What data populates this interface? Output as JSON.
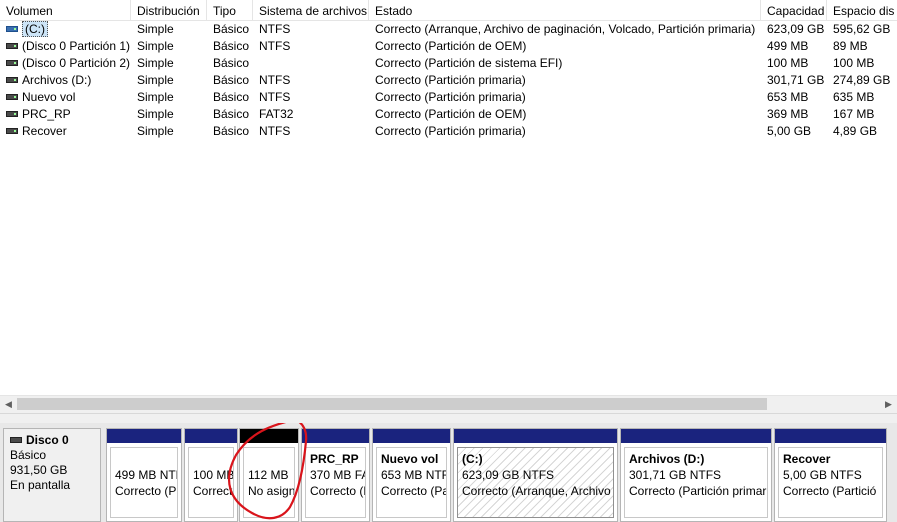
{
  "volume_list": {
    "columns": [
      "Volumen",
      "Distribución",
      "Tipo",
      "Sistema de archivos",
      "Estado",
      "Capacidad",
      "Espacio dis"
    ],
    "rows": [
      {
        "icon": "system-volume-icon",
        "name": "(C:)",
        "layout": "Simple",
        "type": "Básico",
        "fs": "NTFS",
        "status": "Correcto (Arranque, Archivo de paginación, Volcado, Partición primaria)",
        "capacity": "623,09 GB",
        "free": "595,62 GB"
      },
      {
        "icon": "volume-icon",
        "name": "(Disco 0 Partición 1)",
        "layout": "Simple",
        "type": "Básico",
        "fs": "NTFS",
        "status": "Correcto (Partición de OEM)",
        "capacity": "499 MB",
        "free": "89 MB"
      },
      {
        "icon": "volume-icon",
        "name": "(Disco 0 Partición 2)",
        "layout": "Simple",
        "type": "Básico",
        "fs": "",
        "status": "Correcto (Partición de sistema EFI)",
        "capacity": "100 MB",
        "free": "100 MB"
      },
      {
        "icon": "volume-icon",
        "name": "Archivos (D:)",
        "layout": "Simple",
        "type": "Básico",
        "fs": "NTFS",
        "status": "Correcto (Partición primaria)",
        "capacity": "301,71 GB",
        "free": "274,89 GB"
      },
      {
        "icon": "volume-icon",
        "name": "Nuevo vol",
        "layout": "Simple",
        "type": "Básico",
        "fs": "NTFS",
        "status": "Correcto (Partición primaria)",
        "capacity": "653 MB",
        "free": "635 MB"
      },
      {
        "icon": "volume-icon",
        "name": "PRC_RP",
        "layout": "Simple",
        "type": "Básico",
        "fs": "FAT32",
        "status": "Correcto (Partición de OEM)",
        "capacity": "369 MB",
        "free": "167 MB"
      },
      {
        "icon": "volume-icon",
        "name": "Recover",
        "layout": "Simple",
        "type": "Básico",
        "fs": "NTFS",
        "status": "Correcto (Partición primaria)",
        "capacity": "5,00 GB",
        "free": "4,89 GB"
      }
    ]
  },
  "disk": {
    "name": "Disco 0",
    "type": "Básico",
    "size": "931,50 GB",
    "state": "En pantalla",
    "partitions": [
      {
        "title": "",
        "size": "499 MB NTF",
        "status": "Correcto (P",
        "bar_color": "#1a237e",
        "hatched": false
      },
      {
        "title": "",
        "size": "100 MB",
        "status": "Correcto",
        "bar_color": "#1a237e",
        "hatched": false
      },
      {
        "title": "",
        "size": "112 MB",
        "status": "No asign",
        "bar_color": "#000000",
        "hatched": false
      },
      {
        "title": "PRC_RP",
        "size": "370 MB FAT",
        "status": "Correcto (P",
        "bar_color": "#1a237e",
        "hatched": false
      },
      {
        "title": "Nuevo vol",
        "size": "653 MB NTF",
        "status": "Correcto (Pa",
        "bar_color": "#1a237e",
        "hatched": false
      },
      {
        "title": "(C:)",
        "size": "623,09 GB NTFS",
        "status": "Correcto (Arranque, Archivo",
        "bar_color": "#1a237e",
        "hatched": true
      },
      {
        "title": "Archivos  (D:)",
        "size": "301,71 GB NTFS",
        "status": "Correcto (Partición primari",
        "bar_color": "#1a237e",
        "hatched": false
      },
      {
        "title": "Recover",
        "size": "5,00 GB NTFS",
        "status": "Correcto (Partició",
        "bar_color": "#1a237e",
        "hatched": false
      }
    ]
  },
  "annotation": {
    "color": "#d9141b"
  }
}
